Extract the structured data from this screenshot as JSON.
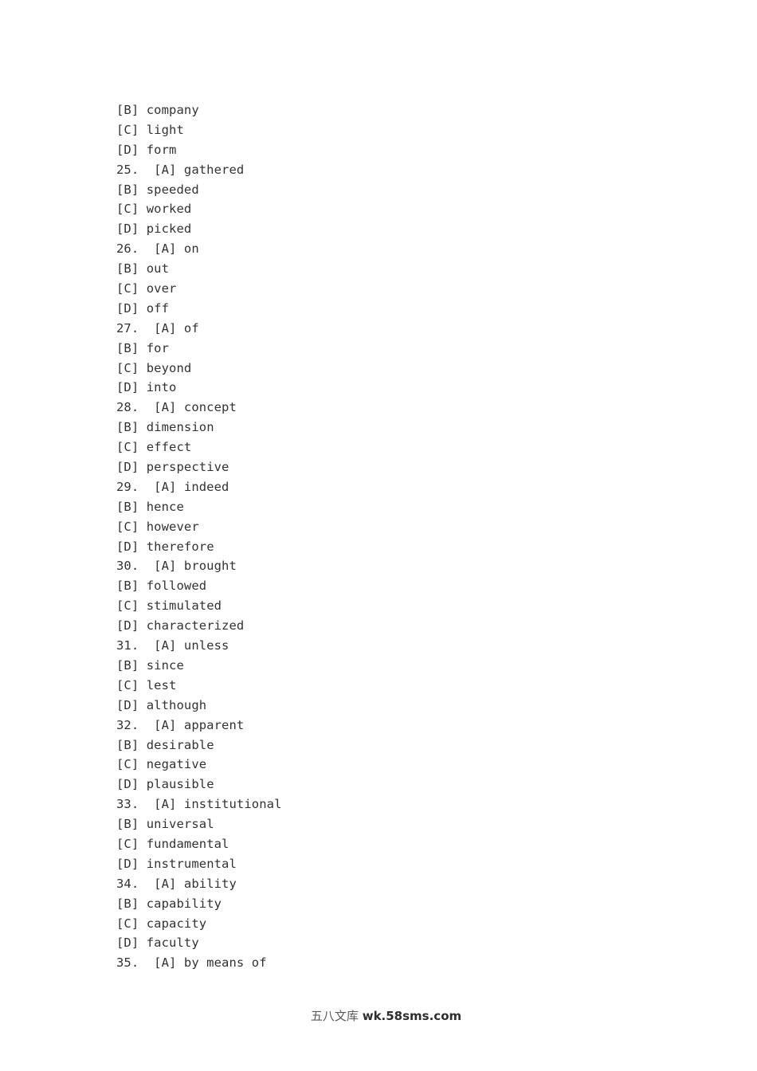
{
  "page": {
    "background_color": "#ffffff",
    "text_color": "#333333"
  },
  "document": {
    "type": "multiple-choice-answer-options",
    "lines": [
      {
        "number": "",
        "letter": "[B]",
        "word": "company"
      },
      {
        "number": "",
        "letter": "[C]",
        "word": "light"
      },
      {
        "number": "",
        "letter": "[D]",
        "word": "form"
      },
      {
        "number": "25.",
        "letter": "[A]",
        "word": "gathered"
      },
      {
        "number": "",
        "letter": "[B]",
        "word": "speeded"
      },
      {
        "number": "",
        "letter": "[C]",
        "word": "worked"
      },
      {
        "number": "",
        "letter": "[D]",
        "word": "picked"
      },
      {
        "number": "26.",
        "letter": "[A]",
        "word": "on"
      },
      {
        "number": "",
        "letter": "[B]",
        "word": "out"
      },
      {
        "number": "",
        "letter": "[C]",
        "word": "over"
      },
      {
        "number": "",
        "letter": "[D]",
        "word": "off"
      },
      {
        "number": "27.",
        "letter": "[A]",
        "word": "of"
      },
      {
        "number": "",
        "letter": "[B]",
        "word": "for"
      },
      {
        "number": "",
        "letter": "[C]",
        "word": "beyond"
      },
      {
        "number": "",
        "letter": "[D]",
        "word": "into"
      },
      {
        "number": "28.",
        "letter": "[A]",
        "word": "concept"
      },
      {
        "number": "",
        "letter": "[B]",
        "word": "dimension"
      },
      {
        "number": "",
        "letter": "[C]",
        "word": "effect"
      },
      {
        "number": "",
        "letter": "[D]",
        "word": "perspective"
      },
      {
        "number": "29.",
        "letter": "[A]",
        "word": "indeed"
      },
      {
        "number": "",
        "letter": "[B]",
        "word": "hence"
      },
      {
        "number": "",
        "letter": "[C]",
        "word": "however"
      },
      {
        "number": "",
        "letter": "[D]",
        "word": "therefore"
      },
      {
        "number": "30.",
        "letter": "[A]",
        "word": "brought"
      },
      {
        "number": "",
        "letter": "[B]",
        "word": "followed"
      },
      {
        "number": "",
        "letter": "[C]",
        "word": "stimulated"
      },
      {
        "number": "",
        "letter": "[D]",
        "word": "characterized"
      },
      {
        "number": "31.",
        "letter": "[A]",
        "word": "unless"
      },
      {
        "number": "",
        "letter": "[B]",
        "word": "since"
      },
      {
        "number": "",
        "letter": "[C]",
        "word": "lest"
      },
      {
        "number": "",
        "letter": "[D]",
        "word": "although"
      },
      {
        "number": "32.",
        "letter": "[A]",
        "word": "apparent"
      },
      {
        "number": "",
        "letter": "[B]",
        "word": "desirable"
      },
      {
        "number": "",
        "letter": "[C]",
        "word": "negative"
      },
      {
        "number": "",
        "letter": "[D]",
        "word": "plausible"
      },
      {
        "number": "33.",
        "letter": "[A]",
        "word": "institutional"
      },
      {
        "number": "",
        "letter": "[B]",
        "word": "universal"
      },
      {
        "number": "",
        "letter": "[C]",
        "word": "fundamental"
      },
      {
        "number": "",
        "letter": "[D]",
        "word": "instrumental"
      },
      {
        "number": "34.",
        "letter": "[A]",
        "word": "ability"
      },
      {
        "number": "",
        "letter": "[B]",
        "word": "capability"
      },
      {
        "number": "",
        "letter": "[C]",
        "word": "capacity"
      },
      {
        "number": "",
        "letter": "[D]",
        "word": "faculty"
      },
      {
        "number": "35.",
        "letter": "[A]",
        "word": "by means of"
      }
    ]
  },
  "watermark": {
    "chinese": "五八文库",
    "url": "wk.58sms.com",
    "separator": " "
  }
}
